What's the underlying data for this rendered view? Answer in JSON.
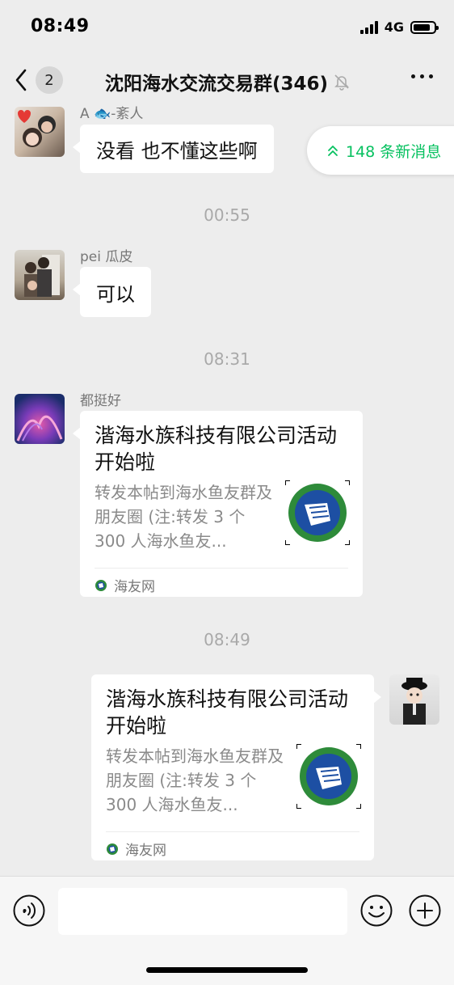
{
  "status_bar": {
    "time": "08:49",
    "network": "4G",
    "battery_level": 0.85
  },
  "nav": {
    "back_count": "2",
    "title": "沈阳海水交流交易群(346)",
    "icons": {
      "back": "chevron-left-icon",
      "mute": "bell-slash-icon",
      "more": "more-dots-icon"
    }
  },
  "new_messages": {
    "label": "148 条新消息",
    "icon": "double-chevron-up-icon",
    "color": "#07c160"
  },
  "messages": [
    {
      "type": "text",
      "sender": "A 🐟-紊人",
      "text": "没看 也不懂这些啊",
      "side": "left"
    },
    {
      "type": "time",
      "text": "00:55"
    },
    {
      "type": "text",
      "sender": "pei 瓜皮",
      "text": "可以",
      "side": "left"
    },
    {
      "type": "time",
      "text": "08:31"
    },
    {
      "type": "link",
      "sender": "都挺好",
      "title": "湝海水族科技有限公司活动开始啦",
      "desc": "转发本帖到海水鱼友群及朋友圈 (注:转发 3 个 300 人海水鱼友...",
      "source": "海友网",
      "side": "left"
    },
    {
      "type": "time",
      "text": "08:49"
    },
    {
      "type": "link",
      "title": "湝海水族科技有限公司活动开始啦",
      "desc": "转发本帖到海水鱼友群及朋友圈 (注:转发 3 个 300 人海水鱼友...",
      "source": "海友网",
      "side": "right"
    }
  ],
  "input_bar": {
    "placeholder": "",
    "icons": {
      "voice": "voice-icon",
      "emoji": "emoji-icon",
      "plus": "plus-icon"
    }
  },
  "colors": {
    "background": "#ededed",
    "bubble": "#ffffff",
    "accent": "#07c160",
    "timestamp": "#a9a9a9"
  }
}
